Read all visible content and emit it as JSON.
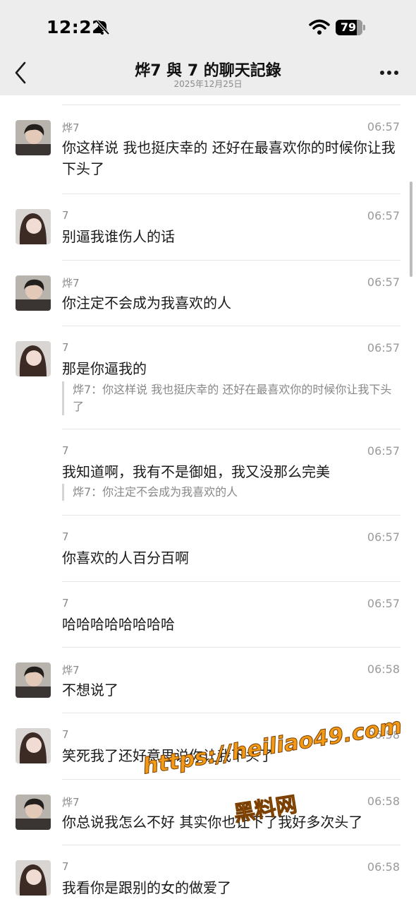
{
  "status_bar": {
    "time": "12:22",
    "battery": "79",
    "battery_level": 0.79
  },
  "nav": {
    "title": "烨7 與 7 的聊天記錄",
    "subtitle": "2025年12月25日"
  },
  "messages": [
    {
      "sender": "烨7",
      "time": "06:57",
      "avatar": "boy-avatar",
      "text": "你这样说 我也挺庆幸的 还好在最喜欢你的时候你让我下头了",
      "quote": ""
    },
    {
      "sender": "7",
      "time": "06:57",
      "avatar": "girl-avatar",
      "text": "别逼我谁伤人的话",
      "quote": ""
    },
    {
      "sender": "烨7",
      "time": "06:57",
      "avatar": "boy-avatar",
      "text": "你注定不会成为我喜欢的人",
      "quote": ""
    },
    {
      "sender": "7",
      "time": "06:57",
      "avatar": "girl-avatar",
      "text": "那是你逼我的",
      "quote": "烨7：你这样说 我也挺庆幸的 还好在最喜欢你的时候你让我下头了"
    },
    {
      "sender": "7",
      "time": "06:57",
      "avatar": "",
      "text": "我知道啊，我有不是御姐，我又没那么完美",
      "quote": "烨7：你注定不会成为我喜欢的人"
    },
    {
      "sender": "7",
      "time": "06:57",
      "avatar": "",
      "text": "你喜欢的人百分百啊",
      "quote": ""
    },
    {
      "sender": "7",
      "time": "06:57",
      "avatar": "",
      "text": "哈哈哈哈哈哈哈哈",
      "quote": ""
    },
    {
      "sender": "烨7",
      "time": "06:58",
      "avatar": "boy-avatar",
      "text": "不想说了",
      "quote": ""
    },
    {
      "sender": "7",
      "time": "06:58",
      "avatar": "girl-avatar",
      "text": "笑死我了还好意思说你让我下头了",
      "quote": ""
    },
    {
      "sender": "烨7",
      "time": "06:58",
      "avatar": "boy-avatar",
      "text": "你总说我怎么不好 其实你也让下了我好多次头了",
      "quote": ""
    },
    {
      "sender": "7",
      "time": "06:58",
      "avatar": "girl-avatar",
      "text": "我看你是跟别的女的做爱了",
      "quote": ""
    }
  ],
  "watermark": {
    "url": "https://heiliao49.com",
    "brand": "黑料网"
  },
  "colors": {
    "header_bg": "#ededed",
    "text": "#1a1a1a",
    "meta": "#9a9a9a",
    "watermark": "#f29a16"
  }
}
